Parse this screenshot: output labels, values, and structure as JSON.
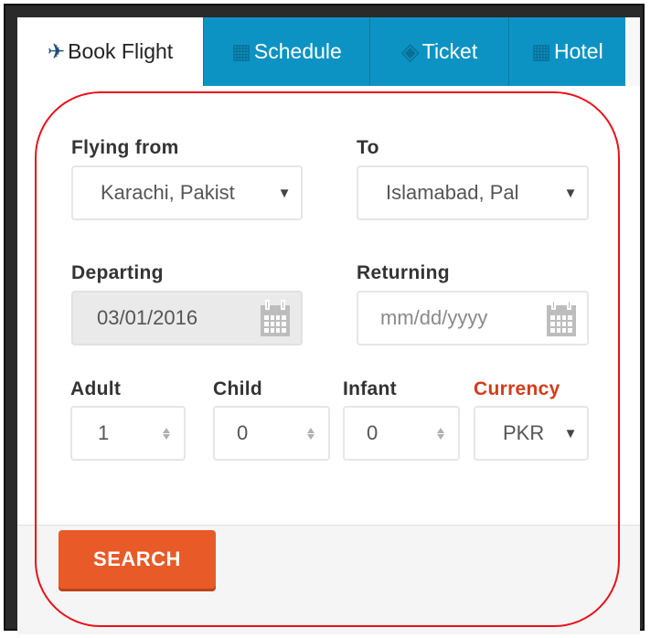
{
  "tabs": [
    {
      "label": "Book Flight",
      "icon": "airplane-icon",
      "active": true
    },
    {
      "label": "Schedule",
      "icon": "building-icon",
      "active": false
    },
    {
      "label": "Ticket",
      "icon": "ticket-icon",
      "active": false
    },
    {
      "label": "Hotel",
      "icon": "hotel-icon",
      "active": false
    }
  ],
  "form": {
    "flying_from": {
      "label": "Flying from",
      "value": "Karachi, Pakist"
    },
    "to": {
      "label": "To",
      "value": "Islamabad, Pal"
    },
    "departing": {
      "label": "Departing",
      "value": "03/01/2016"
    },
    "returning": {
      "label": "Returning",
      "placeholder": "mm/dd/yyyy"
    },
    "adult": {
      "label": "Adult",
      "value": "1"
    },
    "child": {
      "label": "Child",
      "value": "0"
    },
    "infant": {
      "label": "Infant",
      "value": "0"
    },
    "currency": {
      "label": "Currency",
      "value": "PKR"
    }
  },
  "search_button": {
    "label": "SEARCH"
  },
  "colors": {
    "tab_blue": "#0c93c4",
    "search_orange": "#e85a27",
    "currency_red": "#d23c1b",
    "highlight_ring": "#e8121a"
  }
}
